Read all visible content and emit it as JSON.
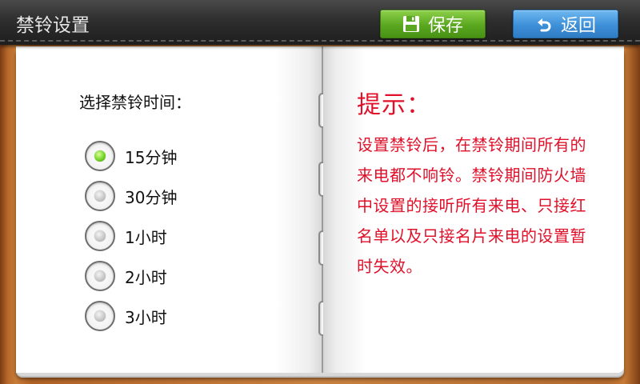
{
  "header": {
    "title": "禁铃设置",
    "save_label": "保存",
    "back_label": "返回",
    "save_icon": "floppy-disk-icon",
    "back_icon": "undo-arrow-icon"
  },
  "left_page": {
    "prompt": "选择禁铃时间：",
    "options": [
      {
        "label": "15分钟",
        "checked": true
      },
      {
        "label": "30分钟",
        "checked": false
      },
      {
        "label": "1小时",
        "checked": false
      },
      {
        "label": "2小时",
        "checked": false
      },
      {
        "label": "3小时",
        "checked": false
      }
    ]
  },
  "right_page": {
    "tip_title": "提示：",
    "tip_text": "设置禁铃后，在禁铃期间所有的来电都不响铃。禁铃期间防火墙中设置的接听所有来电、只接红名单以及只接名片来电的设置暂时失效。"
  },
  "colors": {
    "tip_red": "#e0102a",
    "save_green": "#5aa720",
    "back_blue": "#3d8fd8",
    "radio_checked": "#6ccf1e"
  }
}
